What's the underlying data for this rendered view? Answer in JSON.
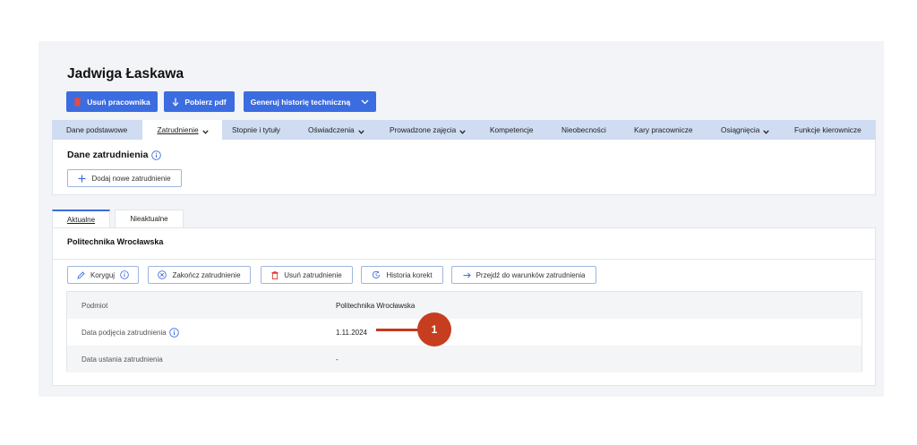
{
  "header": {
    "title": "Jadwiga Łaskawa",
    "buttons": {
      "delete_employee": "Usuń pracownika",
      "download_pdf": "Pobierz pdf",
      "generate_history": "Generuj historię techniczną"
    }
  },
  "tabs": [
    {
      "label": "Dane podstawowe"
    },
    {
      "label": "Zatrudnienie"
    },
    {
      "label": "Stopnie i tytuły"
    },
    {
      "label": "Oświadczenia"
    },
    {
      "label": "Prowadzone zajęcia"
    },
    {
      "label": "Kompetencje"
    },
    {
      "label": "Nieobecności"
    },
    {
      "label": "Kary pracownicze"
    },
    {
      "label": "Osiągnięcia"
    },
    {
      "label": "Funkcje kierownicze"
    }
  ],
  "employment": {
    "title": "Dane zatrudnienia",
    "add_button": "Dodaj nowe zatrudnienie"
  },
  "subtabs": {
    "current": "Aktualne",
    "inactive": "Nieaktualne"
  },
  "panel": {
    "title": "Politechnika Wrocławska",
    "actions": {
      "correct": "Koryguj",
      "end": "Zakończ zatrudnienie",
      "delete": "Usuń zatrudnienie",
      "history": "Historia korekt",
      "goto_terms": "Przejdź do warunków zatrudnienia"
    },
    "rows": [
      {
        "label": "Podmiot",
        "value": "Politechnika Wrocławska"
      },
      {
        "label": "Data podjęcia zatrudnienia",
        "value": "1.11.2024"
      },
      {
        "label": "Data ustania zatrudnienia",
        "value": "-"
      }
    ]
  },
  "callout": {
    "number": "1"
  },
  "colors": {
    "primary": "#3b6ce0",
    "tab_bar": "#cfdcf2",
    "callout": "#c73d1f",
    "danger_icon": "#d9342b"
  }
}
